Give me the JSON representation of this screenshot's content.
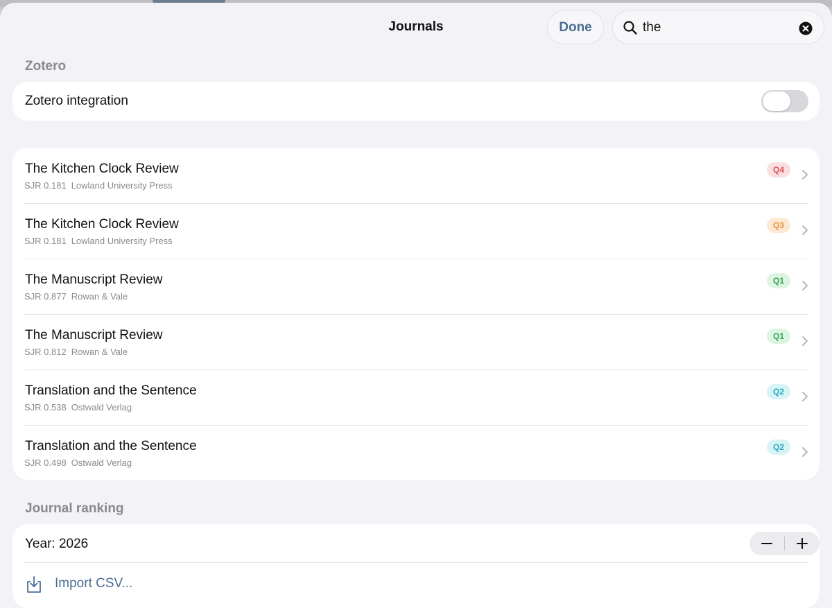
{
  "header": {
    "title": "Journals",
    "done_label": "Done",
    "search": {
      "value": "the",
      "placeholder": "Search"
    }
  },
  "zotero": {
    "section_title": "Zotero",
    "integration_label": "Zotero integration",
    "integration_enabled": false
  },
  "journals": [
    {
      "title": "The Kitchen Clock Review",
      "sjr": "SJR 0.181",
      "publisher": "Lowland University Press",
      "quartile": "Q4"
    },
    {
      "title": "The Kitchen Clock Review",
      "sjr": "SJR 0.181",
      "publisher": "Lowland University Press",
      "quartile": "Q3"
    },
    {
      "title": "The Manuscript Review",
      "sjr": "SJR 0.877",
      "publisher": "Rowan & Vale",
      "quartile": "Q1"
    },
    {
      "title": "The Manuscript Review",
      "sjr": "SJR 0.812",
      "publisher": "Rowan & Vale",
      "quartile": "Q1"
    },
    {
      "title": "Translation and the Sentence",
      "sjr": "SJR 0.538",
      "publisher": "Ostwald Verlag",
      "quartile": "Q2"
    },
    {
      "title": "Translation and the Sentence",
      "sjr": "SJR 0.498",
      "publisher": "Ostwald Verlag",
      "quartile": "Q2"
    }
  ],
  "quartile_colors": {
    "Q1": {
      "bg": "#dcf5e2",
      "fg": "#3aa357"
    },
    "Q2": {
      "bg": "#d6f3f7",
      "fg": "#2aa9bd"
    },
    "Q3": {
      "bg": "#fde8d4",
      "fg": "#e8923c"
    },
    "Q4": {
      "bg": "#fbdfe0",
      "fg": "#d9535a"
    }
  },
  "ranking": {
    "section_title": "Journal ranking",
    "year_label": "Year: 2026",
    "decrement_label": "−",
    "increment_label": "+",
    "import_label": "Import CSV..."
  },
  "colors": {
    "accent": "#4c6d92",
    "background": "#f2f2f7",
    "card": "#ffffff",
    "secondary_text": "#8a8a8e"
  },
  "icons": {
    "search": "magnifying-glass",
    "clear": "xmark-circle-fill",
    "chevron": "chevron-right",
    "import": "square-and-arrow-down"
  }
}
